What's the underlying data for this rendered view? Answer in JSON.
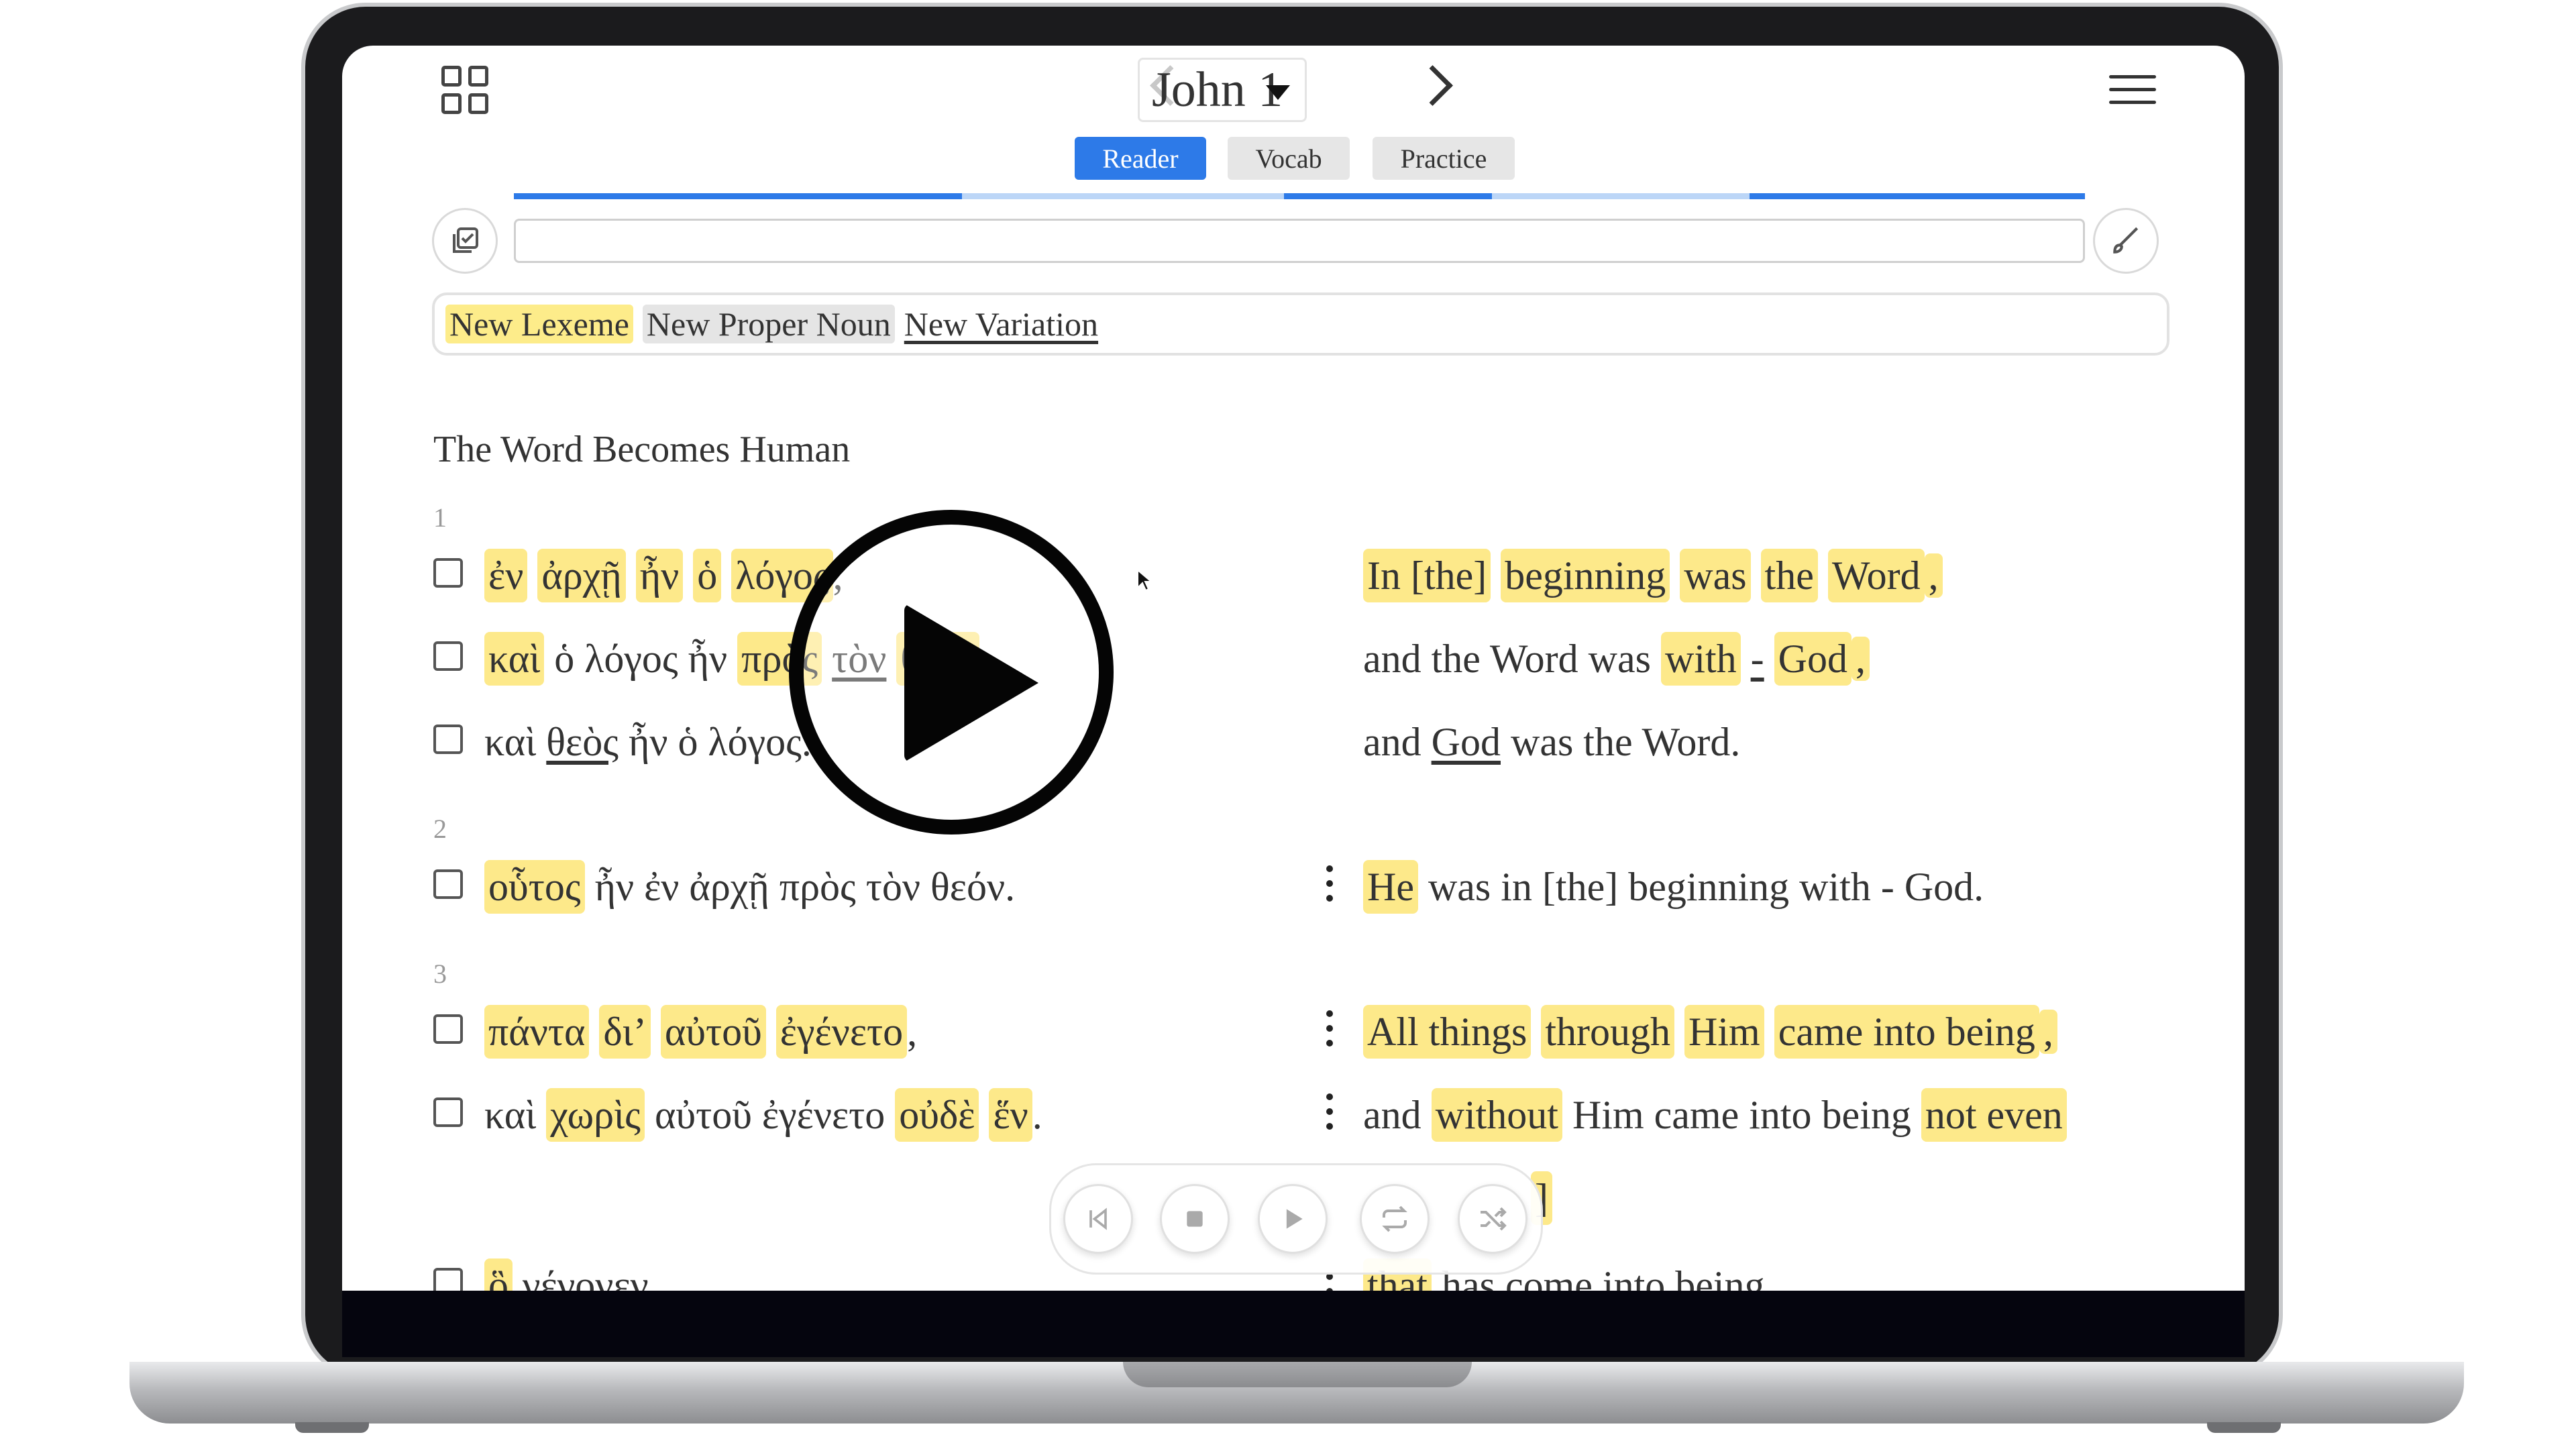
{
  "header": {
    "chapter": "John 1",
    "tabs": [
      "Reader",
      "Vocab",
      "Practice"
    ],
    "active_tab": "Reader"
  },
  "search": {
    "value": "",
    "placeholder": ""
  },
  "legend": {
    "new_lexeme": "New Lexeme",
    "new_proper_noun": "New Proper Noun",
    "new_variation": "New Variation"
  },
  "section_title": "The Word Becomes Human",
  "verses": [
    {
      "number": "1",
      "lines": [
        {
          "greek": [
            "ἐν",
            "ἀρχῇ",
            "ἦν",
            "ὁ",
            "λόγος",
            ","
          ],
          "english": [
            "In [the]",
            "beginning",
            "was",
            "the",
            "Word",
            ","
          ]
        },
        {
          "greek": [
            "καὶ",
            "ὁ λόγος ἦν",
            "πρὸς",
            "τὸν",
            "θεόν",
            ","
          ],
          "english": [
            "and",
            "the Word was",
            "with",
            "-",
            "God",
            ","
          ]
        },
        {
          "greek": [
            "καὶ",
            "θεὸς",
            "ἦν ὁ λόγος."
          ],
          "english": [
            "and",
            "God",
            "was the Word."
          ]
        }
      ]
    },
    {
      "number": "2",
      "lines": [
        {
          "greek": [
            "οὗτος",
            "ἦν ἐν ἀρχῇ πρὸς τὸν θεόν."
          ],
          "english": [
            "He",
            "was in [the] beginning with - God."
          ]
        }
      ]
    },
    {
      "number": "3",
      "lines": [
        {
          "greek": [
            "πάντα",
            "δι’",
            "αὐτοῦ",
            "ἐγένετο",
            ","
          ],
          "english": [
            "All things",
            "through",
            "Him",
            "came into being",
            ","
          ]
        },
        {
          "greek": [
            "καὶ",
            "χωρὶς",
            "αὐτοῦ ἐγένετο",
            "οὐδὲ",
            "ἕν",
            "."
          ],
          "english": [
            "and",
            "without",
            "Him came into being",
            "not even"
          ]
        },
        {
          "greek": [
            ""
          ],
          "english": [
            "]"
          ]
        },
        {
          "greek": [
            "ὃ",
            "γέγονεν."
          ],
          "english": [
            "that",
            "has come into being."
          ]
        }
      ]
    }
  ],
  "player": {
    "buttons": [
      "previous",
      "stop",
      "play",
      "repeat",
      "shuffle"
    ]
  },
  "colors": {
    "highlight": "#fde98a",
    "accent": "#2d7ae8",
    "progress_light": "#bcd6f7"
  },
  "progress_segments": [
    1,
    0,
    1,
    0,
    1
  ]
}
